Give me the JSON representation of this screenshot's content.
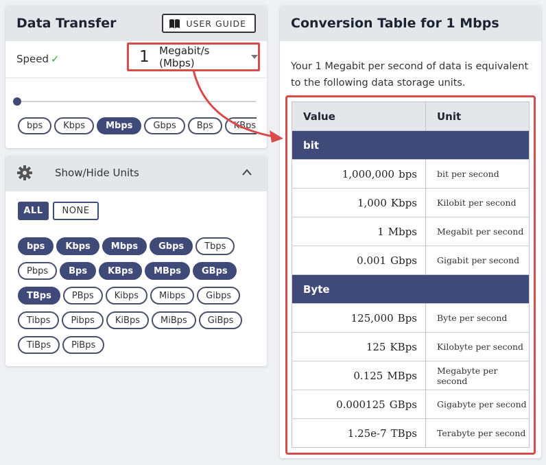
{
  "left": {
    "title": "Data Transfer",
    "guide_label": "USER GUIDE",
    "speed_label": "Speed",
    "speed_check": "✓",
    "value": "1",
    "selected_unit": "Megabit/s (Mbps)",
    "quick_units": [
      {
        "label": "bps",
        "active": false
      },
      {
        "label": "Kbps",
        "active": false
      },
      {
        "label": "Mbps",
        "active": true
      },
      {
        "label": "Gbps",
        "active": false
      },
      {
        "label": "Bps",
        "active": false
      },
      {
        "label": "KBps",
        "active": false
      }
    ]
  },
  "units_panel": {
    "title": "Show/Hide Units",
    "all_label": "ALL",
    "none_label": "NONE",
    "units": [
      {
        "label": "bps",
        "active": true
      },
      {
        "label": "Kbps",
        "active": true
      },
      {
        "label": "Mbps",
        "active": true
      },
      {
        "label": "Gbps",
        "active": true
      },
      {
        "label": "Tbps",
        "active": false
      },
      {
        "label": "Pbps",
        "active": false
      },
      {
        "label": "Bps",
        "active": true
      },
      {
        "label": "KBps",
        "active": true
      },
      {
        "label": "MBps",
        "active": true
      },
      {
        "label": "GBps",
        "active": true
      },
      {
        "label": "TBps",
        "active": true
      },
      {
        "label": "PBps",
        "active": false
      },
      {
        "label": "Kibps",
        "active": false
      },
      {
        "label": "Mibps",
        "active": false
      },
      {
        "label": "Gibps",
        "active": false
      },
      {
        "label": "Tibps",
        "active": false
      },
      {
        "label": "Pibps",
        "active": false
      },
      {
        "label": "KiBps",
        "active": false
      },
      {
        "label": "MiBps",
        "active": false
      },
      {
        "label": "GiBps",
        "active": false
      },
      {
        "label": "TiBps",
        "active": false
      },
      {
        "label": "PiBps",
        "active": false
      }
    ]
  },
  "right": {
    "title": "Conversion Table for 1 Mbps",
    "intro": "Your 1 Megabit per second of data is equivalent to the following data storage units.",
    "col_value": "Value",
    "col_unit": "Unit",
    "groups": [
      {
        "name": "bit",
        "rows": [
          {
            "value": "1,000,000",
            "unit": "bps",
            "name": "bit per second"
          },
          {
            "value": "1,000",
            "unit": "Kbps",
            "name": "Kilobit per second"
          },
          {
            "value": "1",
            "unit": "Mbps",
            "name": "Megabit per second"
          },
          {
            "value": "0.001",
            "unit": "Gbps",
            "name": "Gigabit per second"
          }
        ]
      },
      {
        "name": "Byte",
        "rows": [
          {
            "value": "125,000",
            "unit": "Bps",
            "name": "Byte per second"
          },
          {
            "value": "125",
            "unit": "KBps",
            "name": "Kilobyte per second"
          },
          {
            "value": "0.125",
            "unit": "MBps",
            "name": "Megabyte per second"
          },
          {
            "value": "0.000125",
            "unit": "GBps",
            "name": "Gigabyte per second"
          },
          {
            "value": "1.25e-7",
            "unit": "TBps",
            "name": "Terabyte per second"
          }
        ]
      }
    ]
  },
  "colors": {
    "accent": "#3f4a78",
    "highlight": "#d94a4a",
    "check": "#3aa34a"
  }
}
